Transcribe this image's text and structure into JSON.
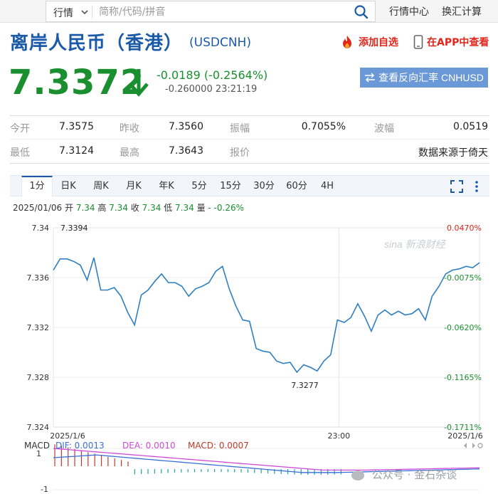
{
  "topbar": {
    "search_type": "行情",
    "search_placeholder": "简称/代码/拼音",
    "links": [
      "行情中心",
      "换汇计算"
    ]
  },
  "header": {
    "title": "离岸人民币（香港）",
    "code": "(USDCNH)",
    "add_watch": "添加自选",
    "app_view": "在APP中查看"
  },
  "quote": {
    "price": "7.3372",
    "change": "-0.0189 (-0.2564%)",
    "sub": "-0.260000 23:21:19",
    "reverse_button": "查看反向汇率 CNHUSD"
  },
  "stats": [
    {
      "label": "今开",
      "value": "7.3575"
    },
    {
      "label": "昨收",
      "value": "7.3560"
    },
    {
      "label": "振幅",
      "value": "0.7055%"
    },
    {
      "label": "波幅",
      "value": "0.0519"
    },
    {
      "label": "最低",
      "value": "7.3124"
    },
    {
      "label": "最高",
      "value": "7.3643"
    },
    {
      "label": "报价",
      "value": "数据来源于倚天"
    }
  ],
  "tabs": [
    "1分",
    "日K",
    "周K",
    "月K",
    "年K",
    "5分",
    "15分",
    "30分",
    "60分",
    "4H"
  ],
  "ohlc": {
    "date": "2025/01/06",
    "open_label": "开",
    "open": "7.34",
    "high_label": "高",
    "high": "7.34",
    "close_label": "收",
    "close": "7.34",
    "low_label": "低",
    "low": "7.34",
    "vol_label": "量",
    "change": "- -0.26%"
  },
  "chart_data": {
    "type": "line",
    "y_ticks": [
      "7.34",
      "7.336",
      "7.332",
      "7.328",
      "7.324"
    ],
    "y_right_ticks": [
      "0.0470%",
      "-0.0075%",
      "-0.0620%",
      "-0.1165%",
      "-0.1711%"
    ],
    "x_ticks": [
      "2025/1/6",
      "23:00",
      "2025/1/6"
    ],
    "ylim": [
      7.324,
      7.34
    ],
    "max_label": "7.3394",
    "min_label": "7.3277",
    "watermark": "sina 新浪财经",
    "series": [
      {
        "values": [
          7.3366,
          7.3375,
          7.3375,
          7.3373,
          7.337,
          7.3358,
          7.3376,
          7.335,
          7.335,
          7.3352,
          7.3345,
          7.3332,
          7.3322,
          7.3346,
          7.335,
          7.3357,
          7.3363,
          7.3356,
          7.3356,
          7.3353,
          7.3345,
          7.3351,
          7.3353,
          7.3356,
          7.3365,
          7.3369,
          7.3351,
          7.3337,
          7.3326,
          7.3325,
          7.3303,
          7.3301,
          7.33,
          7.3293,
          7.3291,
          7.3292,
          7.3284,
          7.329,
          7.3288,
          7.3285,
          7.3293,
          7.3298,
          7.3326,
          7.3324,
          7.3328,
          7.3339,
          7.3329,
          7.3317,
          7.333,
          7.3334,
          7.333,
          7.3333,
          7.333,
          7.3331,
          7.3335,
          7.3326,
          7.3345,
          7.3353,
          7.3363,
          7.3366,
          7.3367,
          7.3369,
          7.3368,
          7.3372
        ]
      }
    ]
  },
  "macd": {
    "label": "MACD",
    "dif": "DIF: 0.0013",
    "dea": "DEA: 0.0010",
    "macd": "MACD: 0.0007",
    "y_top": "1",
    "y_bottom": "-1",
    "dif_color": "#3a6fd8",
    "dea_color": "#d04ad8",
    "macd_color": "#c0392b"
  },
  "watermark_account": "公众号 · 金石杂谈",
  "colors": {
    "up": "#1a8f2f",
    "down": "#e1251b",
    "brand": "#1a5aa8",
    "line": "#2e7fc1"
  }
}
